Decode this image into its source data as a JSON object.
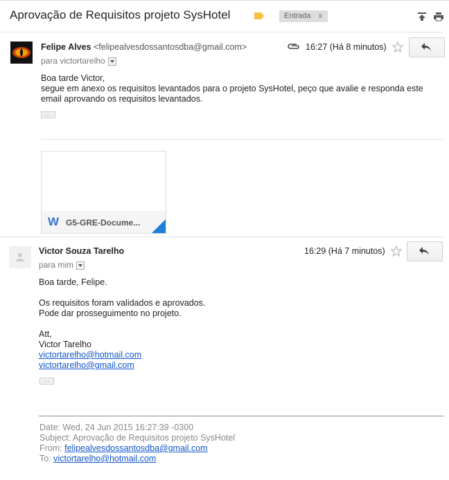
{
  "thread": {
    "subject": "Aprovação de Requisitos projeto SysHotel",
    "label_chip": "Entrada",
    "label_remove": "x"
  },
  "icons": {
    "label": "label-tag-icon",
    "expand": "expand-all-icon",
    "print": "print-icon",
    "attachment": "paperclip-icon",
    "star": "star-icon",
    "reply": "reply-icon"
  },
  "messages": [
    {
      "sender_name": "Felipe Alves",
      "sender_email": "<felipealvesdossantosdba@gmail.com>",
      "recipient": "para victortarelho",
      "time": "16:27 (Há 8 minutos)",
      "body": [
        "Boa tarde Victor,",
        "segue em anexo os requisitos levantados para o projeto SysHotel, peço que avalie e responda este",
        "email aprovando os requisitos levantados."
      ],
      "attachment": {
        "name": "G5-GRE-Docume...",
        "type_letter": "W"
      }
    },
    {
      "sender_name": "Victor Souza Tarelho",
      "recipient": "para mim",
      "time": "16:29 (Há 7 minutos)",
      "body": [
        "Boa tarde, Felipe.",
        "",
        "Os requisitos foram validados e aprovados.",
        "Pode dar prosseguimento no projeto.",
        "",
        "Att,",
        "Victor Tarelho"
      ],
      "links": [
        "victortarelho@hotmail.com",
        "victortarelho@gmail.com"
      ]
    }
  ],
  "quoted_header": {
    "date": "Date: Wed, 24 Jun 2015 16:27:39 -0300",
    "subject": "Subject: Aprovação de Requisitos projeto SysHotel",
    "from_label": "From:",
    "from_email": "felipealvesdossantosdba@gmail.com",
    "to_label": "To:",
    "to_email": "victortarelho@hotmail.com"
  },
  "colors": {
    "link": "#1155cc",
    "attachment_corner": "#1e7fd8",
    "label_tag": "#f5c242",
    "word_icon": "#3a6fd1"
  }
}
